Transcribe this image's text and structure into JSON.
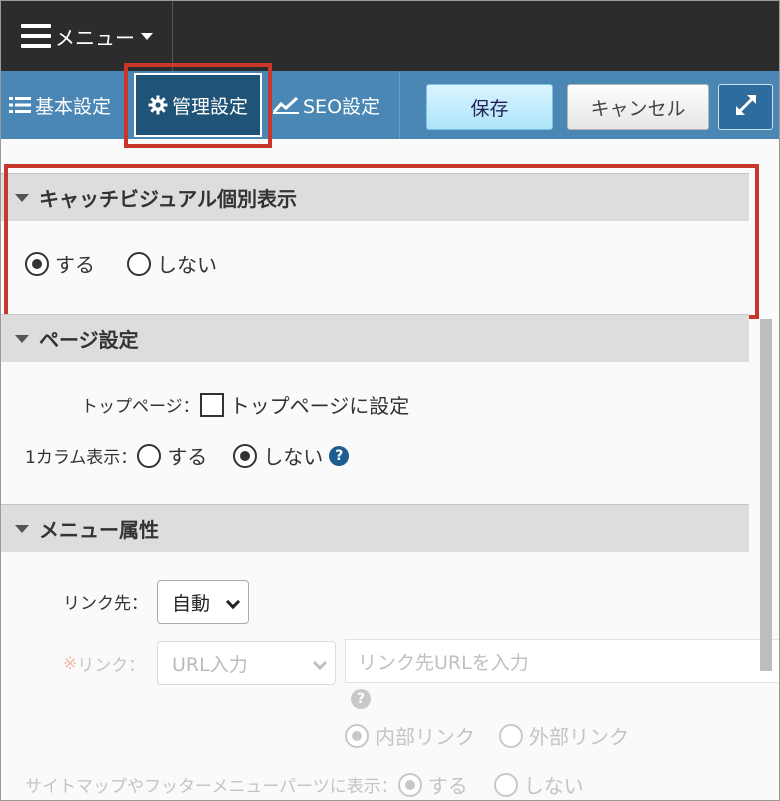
{
  "topbar": {
    "menu_label": "メニュー"
  },
  "tabs": {
    "basic": "基本設定",
    "admin": "管理設定",
    "seo": "SEO設定"
  },
  "buttons": {
    "save": "保存",
    "cancel": "キャンセル"
  },
  "catch_visual": {
    "title": "キャッチビジュアル個別表示",
    "options": [
      "する",
      "しない"
    ],
    "selected": "する"
  },
  "page_settings": {
    "title": "ページ設定",
    "top_page_label": "トップページ：",
    "top_page_checkbox": "トップページに設定",
    "top_page_checked": false,
    "one_column_label": "1カラム表示：",
    "one_column_options": [
      "する",
      "しない"
    ],
    "one_column_selected": "しない"
  },
  "menu_attr": {
    "title": "メニュー属性",
    "link_dest_label": "リンク先：",
    "link_dest_value": "自動",
    "link_label_mark": "※",
    "link_label": "リンク：",
    "link_type_value": "URL入力",
    "url_placeholder": "リンク先URLを入力",
    "link_kind_options": [
      "内部リンク",
      "外部リンク"
    ],
    "link_kind_selected": "内部リンク",
    "sitemap_label": "サイトマップやフッターメニューパーツに表示：",
    "sitemap_options": [
      "する",
      "しない"
    ],
    "sitemap_selected": "する"
  },
  "colors": {
    "topbar": "#2c2c2c",
    "tabbar": "#4a87b4",
    "active_tab": "#1f5377",
    "highlight_outline": "#c8372a",
    "section_header": "#dddddd"
  }
}
